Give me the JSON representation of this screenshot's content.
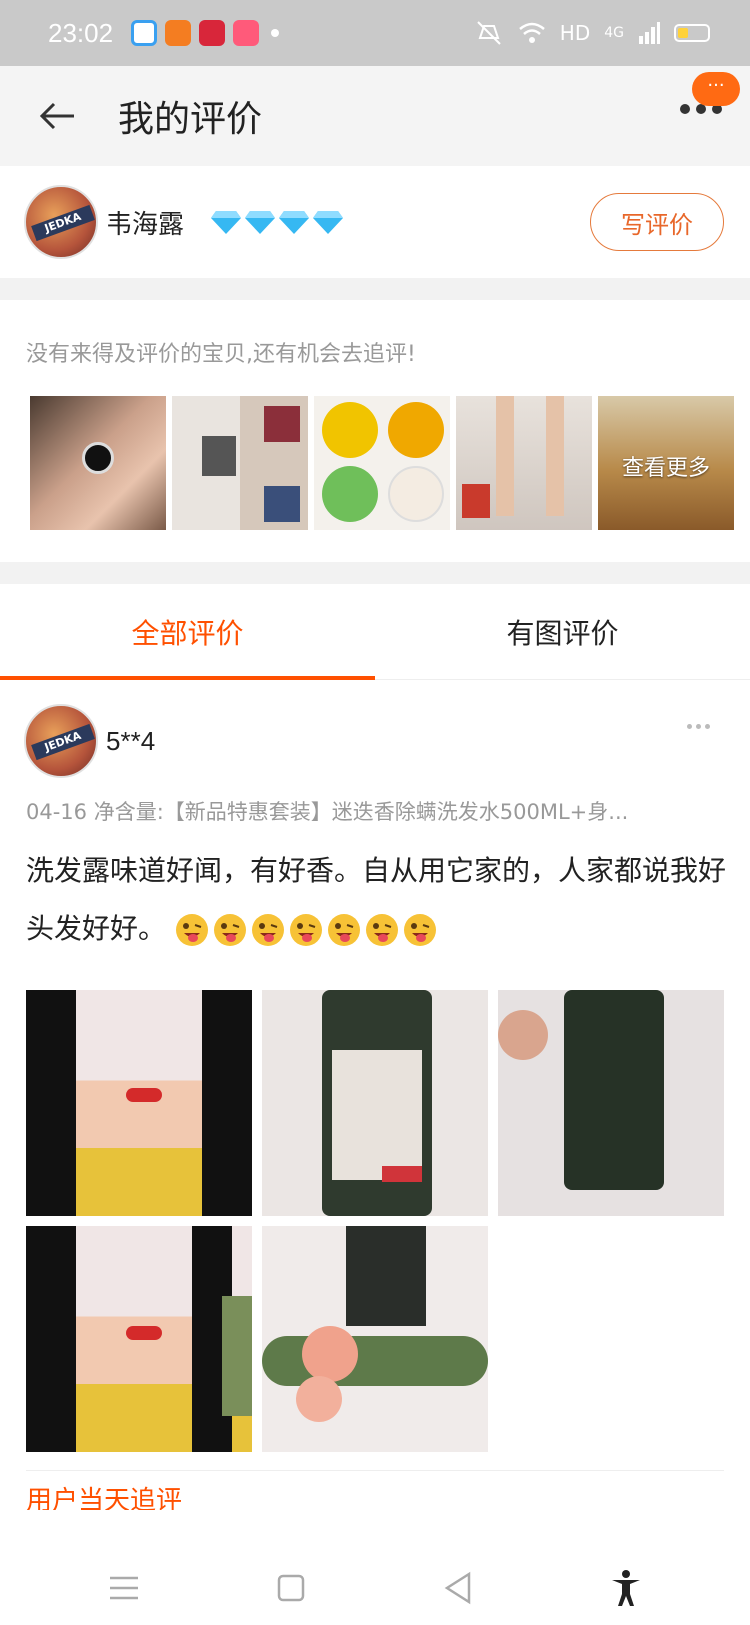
{
  "status_bar": {
    "time": "23:02",
    "hd": "HD",
    "network": "4G"
  },
  "header": {
    "title": "我的评价",
    "menu_badge": "···"
  },
  "user": {
    "name": "韦海露",
    "avatar_text": "JEDKA",
    "write_button": "写评价"
  },
  "pending": {
    "hint": "没有来得及评价的宝贝,还有机会去追评!",
    "more_label": "查看更多",
    "thumbs": [
      {
        "icon": "ring-product-image"
      },
      {
        "icon": "skirt-product-image"
      },
      {
        "icon": "baby-hat-product-image"
      },
      {
        "icon": "stockings-product-image"
      },
      {
        "icon": "food-product-image"
      }
    ]
  },
  "tabs": [
    {
      "label": "全部评价",
      "active": true
    },
    {
      "label": "有图评价",
      "active": false
    }
  ],
  "review": {
    "name": "5**4",
    "meta": "04-16  净含量:【新品特惠套装】迷迭香除螨洗发水500ML+身...",
    "text": "洗发露味道好闻，有好香。自从用它家的，人家都说我好头发好好。",
    "emoji_count": 7,
    "photos": [
      {
        "icon": "selfie-photo"
      },
      {
        "icon": "shampoo-bottle-photo"
      },
      {
        "icon": "bottle-back-photo"
      },
      {
        "icon": "selfie-photo"
      },
      {
        "icon": "bottle-with-flower-photo"
      }
    ],
    "follow_up": "用户当天追评"
  },
  "colors": {
    "accent": "#ff5000",
    "diamond": "#36b8f2"
  }
}
